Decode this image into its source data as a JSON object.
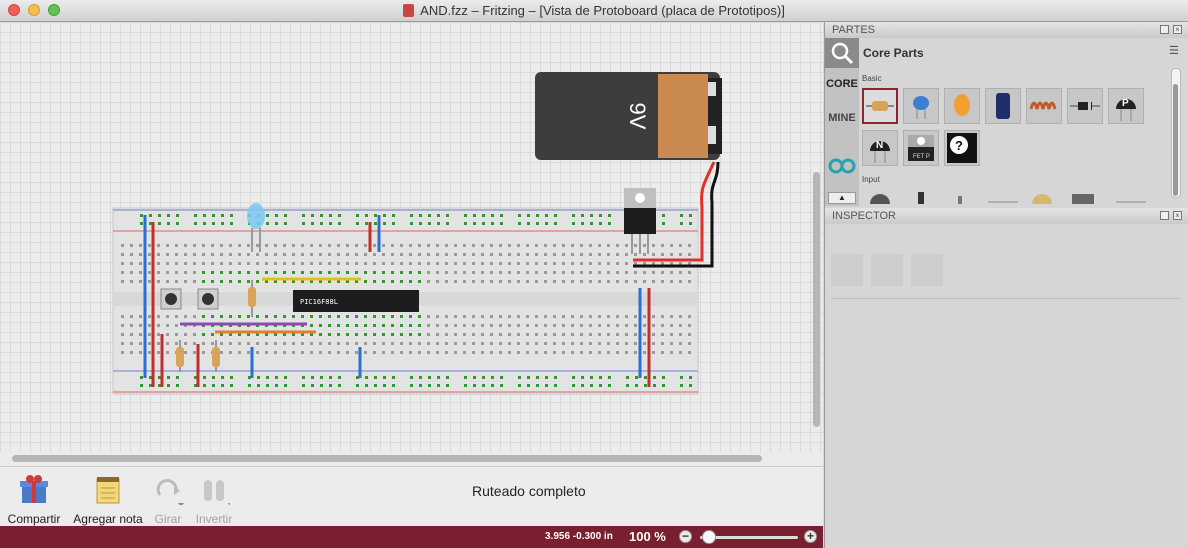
{
  "window": {
    "title": "AND.fzz – Fritzing – [Vista de Protoboard (placa de Prototipos)]"
  },
  "canvas": {
    "battery_label": "9V",
    "chip_label": "PIC16F88L"
  },
  "toolbar": {
    "share_label": "Compartir",
    "add_note_label": "Agregar nota",
    "rotate_label": "Girar",
    "flip_label": "Invertir"
  },
  "status": {
    "message": "Ruteado completo"
  },
  "statusbar": {
    "coordinates": "3.956 -0.300 in",
    "zoom": "100 %",
    "zoom_out": "−",
    "zoom_in": "+"
  },
  "parts_panel": {
    "header": "PARTES",
    "bin_title": "Core Parts",
    "tabs": [
      "CORE",
      "MINE"
    ],
    "categories": [
      "Basic",
      "Input"
    ],
    "parts": [
      "resistor-icon",
      "ceramic-capacitor-icon",
      "tantalum-capacitor-icon",
      "electrolytic-capacitor-icon",
      "inductor-icon",
      "diode-icon",
      "pnp-transistor-icon",
      "npn-transistor-icon",
      "fet-transistor-icon",
      "mystery-part-icon"
    ],
    "fet_label": "FET P",
    "mystery_label": "?"
  },
  "inspector": {
    "header": "INSPECTOR"
  },
  "colors": {
    "statusbar": "#7a1f30",
    "accent": "#8d2631"
  }
}
